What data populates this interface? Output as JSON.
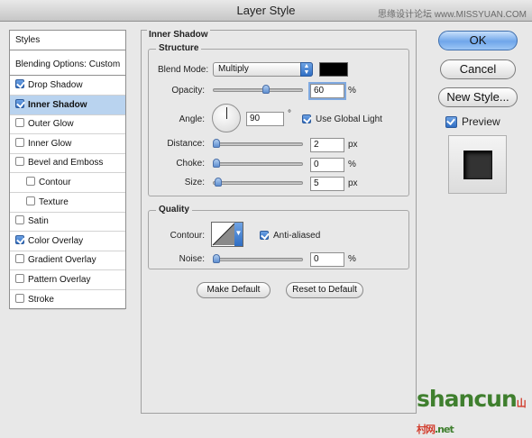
{
  "window": {
    "title": "Layer Style",
    "watermark": "思缘设计论坛 www.MISSYUAN.COM"
  },
  "sidebar": {
    "header": "Styles",
    "blending_options": "Blending Options: Custom",
    "items": [
      {
        "label": "Drop Shadow",
        "checked": true,
        "selected": false,
        "sub": false
      },
      {
        "label": "Inner Shadow",
        "checked": true,
        "selected": true,
        "sub": false
      },
      {
        "label": "Outer Glow",
        "checked": false,
        "selected": false,
        "sub": false
      },
      {
        "label": "Inner Glow",
        "checked": false,
        "selected": false,
        "sub": false
      },
      {
        "label": "Bevel and Emboss",
        "checked": false,
        "selected": false,
        "sub": false
      },
      {
        "label": "Contour",
        "checked": false,
        "selected": false,
        "sub": true
      },
      {
        "label": "Texture",
        "checked": false,
        "selected": false,
        "sub": true
      },
      {
        "label": "Satin",
        "checked": false,
        "selected": false,
        "sub": false
      },
      {
        "label": "Color Overlay",
        "checked": true,
        "selected": false,
        "sub": false
      },
      {
        "label": "Gradient Overlay",
        "checked": false,
        "selected": false,
        "sub": false
      },
      {
        "label": "Pattern Overlay",
        "checked": false,
        "selected": false,
        "sub": false
      },
      {
        "label": "Stroke",
        "checked": false,
        "selected": false,
        "sub": false
      }
    ]
  },
  "panel": {
    "title": "Inner Shadow",
    "structure": {
      "title": "Structure",
      "blend_mode_label": "Blend Mode:",
      "blend_mode_value": "Multiply",
      "color": "#000000",
      "opacity_label": "Opacity:",
      "opacity_value": "60",
      "opacity_unit": "%",
      "opacity_level": 0.6,
      "angle_label": "Angle:",
      "angle_value": "90",
      "angle_unit": "°",
      "use_global_light_label": "Use Global Light",
      "use_global_light_checked": true,
      "distance_label": "Distance:",
      "distance_value": "2",
      "distance_unit": "px",
      "distance_level": 0.0,
      "choke_label": "Choke:",
      "choke_value": "0",
      "choke_unit": "%",
      "choke_level": 0.0,
      "size_label": "Size:",
      "size_value": "5",
      "size_unit": "px",
      "size_level": 0.02
    },
    "quality": {
      "title": "Quality",
      "contour_label": "Contour:",
      "anti_aliased_label": "Anti-aliased",
      "anti_aliased_checked": true,
      "noise_label": "Noise:",
      "noise_value": "0",
      "noise_unit": "%",
      "noise_level": 0.0
    },
    "make_default": "Make Default",
    "reset_to_default": "Reset to Default"
  },
  "actions": {
    "ok": "OK",
    "cancel": "Cancel",
    "new_style": "New Style...",
    "preview_label": "Preview",
    "preview_checked": true
  },
  "logo": {
    "main": "shancun",
    "small": "山村网",
    "suffix": ".net"
  }
}
